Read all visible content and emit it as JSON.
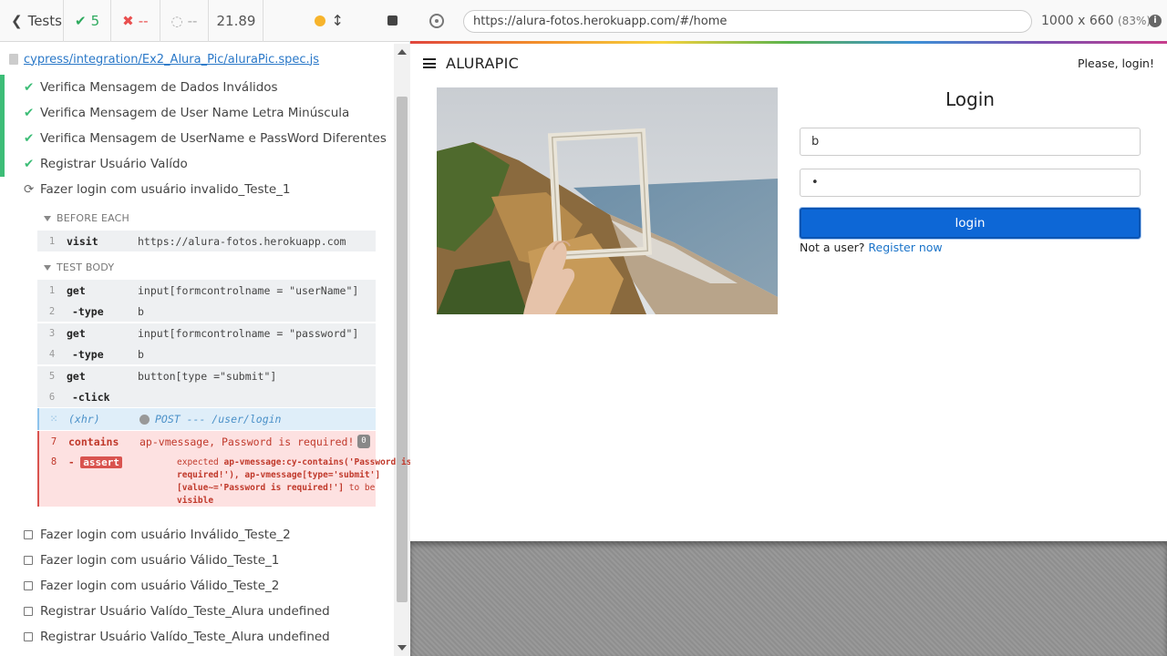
{
  "runner": {
    "tests_label": "Tests",
    "passed_count": "5",
    "failed_count": "--",
    "pending_count": "--",
    "duration": "21.89",
    "spec_path": "cypress/integration/Ex2_Alura_Pic/aluraPic.spec.js"
  },
  "tests": [
    {
      "title": "Verifica Mensagem de Dados Inválidos",
      "state": "passed"
    },
    {
      "title": "Verifica Mensagem de User Name Letra Minúscula",
      "state": "passed"
    },
    {
      "title": "Verifica Mensagem de UserName e PassWord Diferentes",
      "state": "passed"
    },
    {
      "title": "Registrar Usuário Valído",
      "state": "passed"
    },
    {
      "title": "Fazer login com usuário invalido_Teste_1",
      "state": "running"
    },
    {
      "title": "Fazer login com usuário Inválido_Teste_2",
      "state": "pending"
    },
    {
      "title": "Fazer login com usuário Válido_Teste_1",
      "state": "pending"
    },
    {
      "title": "Fazer login com usuário Válido_Teste_2",
      "state": "pending"
    },
    {
      "title": "Registrar Usuário Valído_Teste_Alura undefined",
      "state": "pending"
    },
    {
      "title": "Registrar Usuário Valído_Teste_Alura undefined",
      "state": "pending"
    }
  ],
  "hooks": {
    "before_each_label": "BEFORE EACH",
    "test_body_label": "TEST BODY"
  },
  "before_each_cmds": [
    {
      "num": "1",
      "name": "visit",
      "msg": "https://alura-fotos.herokuapp.com"
    }
  ],
  "body_cmds": [
    {
      "num": "1",
      "name": "get",
      "msg": "input[formcontrolname = \"userName\"]"
    },
    {
      "num": "2",
      "name": "-type",
      "msg": "b"
    },
    {
      "num": "3",
      "name": "get",
      "msg": "input[formcontrolname = \"password\"]"
    },
    {
      "num": "4",
      "name": "-type",
      "msg": "b"
    },
    {
      "num": "5",
      "name": "get",
      "msg": "button[type =\"submit\"]"
    },
    {
      "num": "6",
      "name": "-click",
      "msg": ""
    }
  ],
  "xhr_cmd": {
    "name": "(xhr)",
    "msg": "POST --- /user/login"
  },
  "error_cmd": {
    "num": "7",
    "name": "contains",
    "msg": "ap-vmessage, Password is required!",
    "badge": "0"
  },
  "assert_cmd": {
    "num": "8",
    "dash": "-",
    "tag": "assert",
    "expected_word": "expected",
    "subject": "ap-vmessage:cy-contains('Password is required!'), ap-vmessage[type='submit'][value~='Password is required!']",
    "to_be": "to be",
    "visible": "visible"
  },
  "aut": {
    "url": "https://alura-fotos.herokuapp.com/#/home",
    "viewport": "1000 x 660",
    "scale": "(83%)",
    "info": "i"
  },
  "app": {
    "brand": "ALURAPIC",
    "greeting": "Please, login!",
    "login_title": "Login",
    "username_value": "b",
    "password_value": "•",
    "login_button": "login",
    "not_user_text": "Not a user?",
    "register_link": "Register now"
  },
  "colors": {
    "pass": "#3dbd77",
    "fail": "#e94f4f",
    "primary": "#0d67d6"
  }
}
